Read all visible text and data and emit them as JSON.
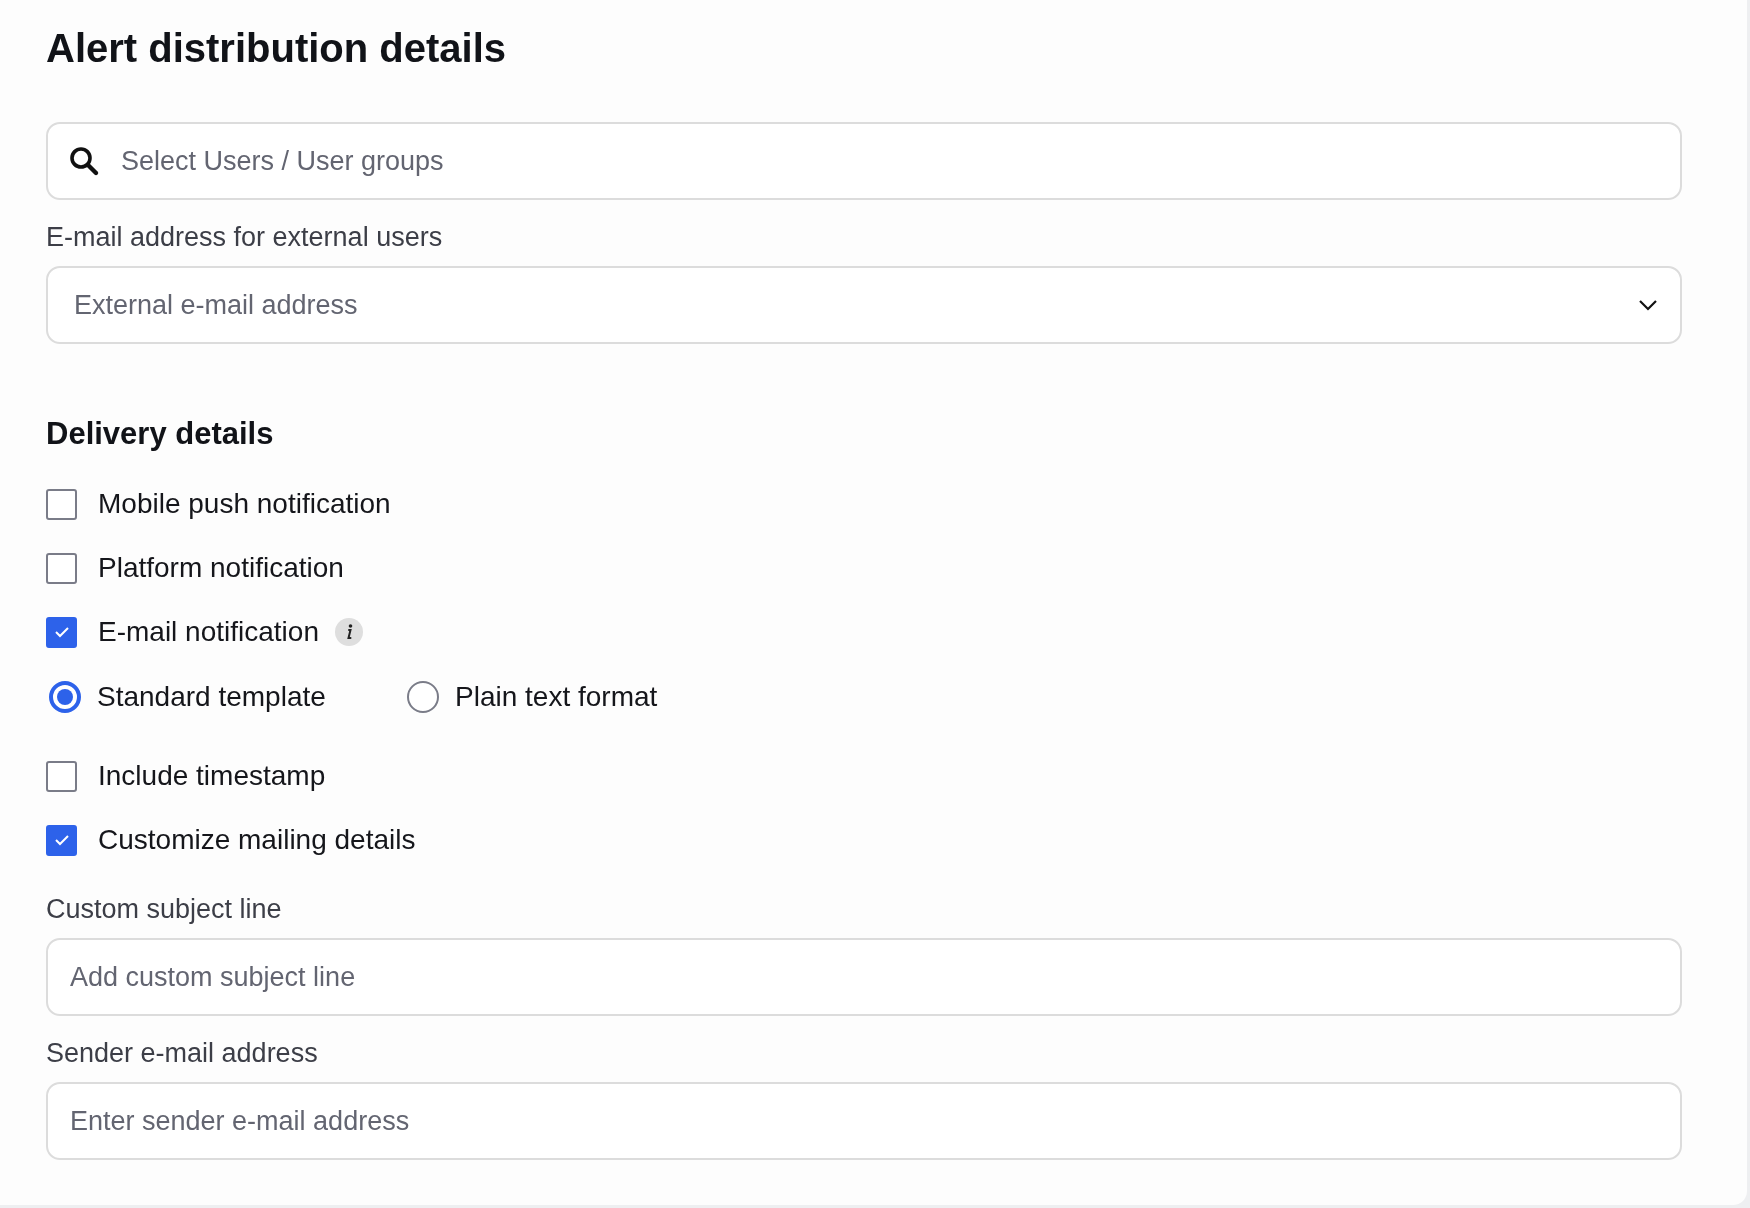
{
  "title": "Alert distribution details",
  "search": {
    "placeholder": "Select Users / User groups"
  },
  "external_email": {
    "label": "E-mail address for external users",
    "placeholder": "External e-mail address"
  },
  "delivery": {
    "heading": "Delivery details",
    "options": [
      {
        "kind": "checkbox",
        "label": "Mobile push notification",
        "checked": false
      },
      {
        "kind": "checkbox",
        "label": "Platform notification",
        "checked": false
      },
      {
        "kind": "checkbox",
        "label": "E-mail notification",
        "checked": true,
        "info": true
      },
      {
        "kind": "radio_group",
        "choices": [
          {
            "label": "Standard template",
            "selected": true
          },
          {
            "label": "Plain text format",
            "selected": false
          }
        ]
      },
      {
        "kind": "checkbox",
        "label": "Include timestamp",
        "checked": false
      },
      {
        "kind": "checkbox",
        "label": "Customize mailing details",
        "checked": true
      }
    ]
  },
  "fields": [
    {
      "label": "Custom subject line",
      "placeholder": "Add custom subject line"
    },
    {
      "label": "Sender e-mail address",
      "placeholder": "Enter sender e-mail address"
    }
  ]
}
